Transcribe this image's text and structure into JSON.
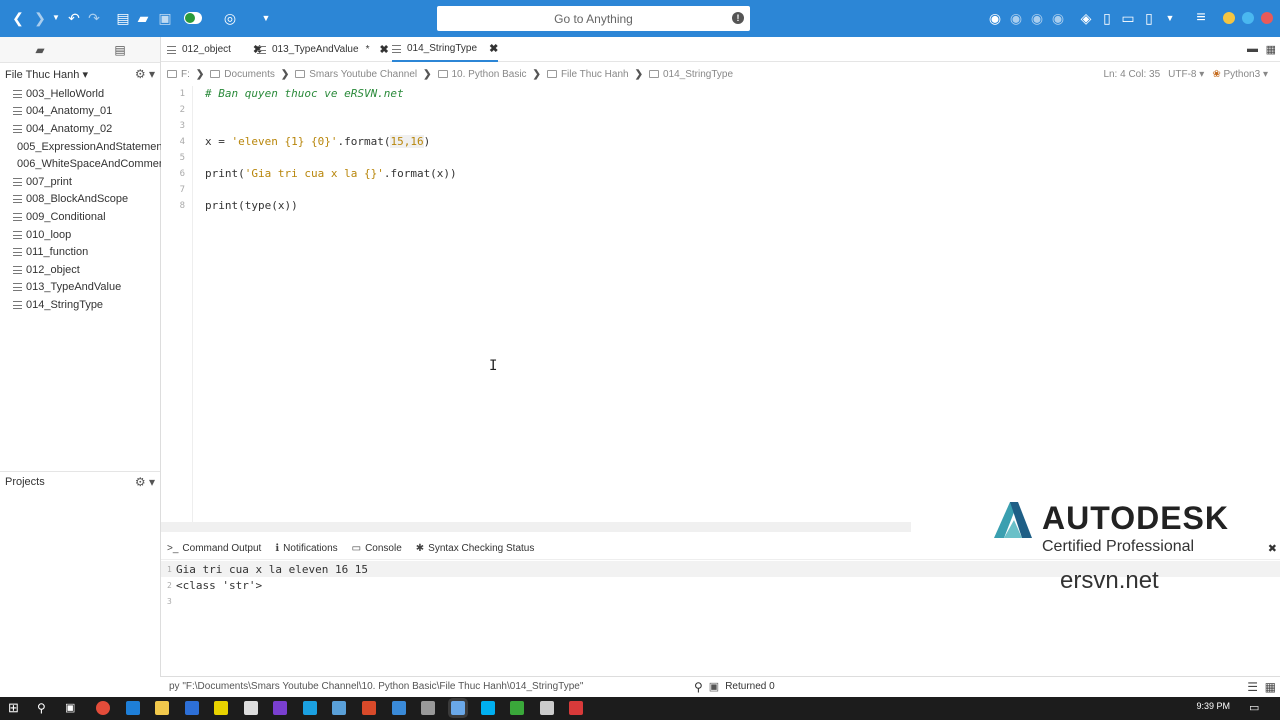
{
  "toolbar": {
    "goto_placeholder": "Go to Anything"
  },
  "sidebar": {
    "folder_name": "File Thuc Hanh",
    "items": [
      "003_HelloWorld",
      "004_Anatomy_01",
      "004_Anatomy_02",
      "005_ExpressionAndStatement",
      "006_WhiteSpaceAndComment",
      "007_print",
      "008_BlockAndScope",
      "009_Conditional",
      "010_loop",
      "011_function",
      "012_object",
      "013_TypeAndValue",
      "014_StringType"
    ],
    "projects_label": "Projects"
  },
  "tabs": [
    {
      "label": "012_object",
      "close": "✖"
    },
    {
      "label": "013_TypeAndValue",
      "modified": "*",
      "close": "✖"
    },
    {
      "label": "014_StringType",
      "close": "✖"
    }
  ],
  "breadcrumb": [
    "F:",
    "Documents",
    "Smars Youtube Channel",
    "10. Python Basic",
    "File Thuc Hanh",
    "014_StringType"
  ],
  "status": {
    "position": "Ln: 4 Col: 35",
    "encoding": "UTF-8",
    "language": "Python3"
  },
  "editor": {
    "line_numbers": [
      "1",
      "2",
      "3",
      "4",
      "5",
      "6",
      "7",
      "8"
    ],
    "line1": "# Ban quyen thuoc ve eRSVN.net",
    "line4_a": "x = ",
    "line4_str": "'eleven {1} {0}'",
    "line4_b": ".format(",
    "line4_args": "15,16",
    "line4_c": ")",
    "line6_a": "print(",
    "line6_str": "'Gia tri cua x la {}'",
    "line6_b": ".format(x))",
    "line8": "print(type(x))"
  },
  "panel": {
    "tabs": [
      "Command Output",
      "Notifications",
      "Console",
      "Syntax Checking Status"
    ],
    "output_lines": [
      "Gia tri cua x la eleven 16 15",
      "<class 'str'>",
      ""
    ],
    "output_line_numbers": [
      "1",
      "2",
      "3"
    ],
    "command": "py \"F:\\Documents\\Smars Youtube Channel\\10. Python Basic\\File Thuc Hanh\\014_StringType\"",
    "returned": "Returned 0",
    "close": "✖"
  },
  "watermark": {
    "brand": "AUTODESK",
    "cert": "Certified Professional",
    "site": "ersvn.net"
  },
  "taskbar": {
    "time": "9:39 PM"
  },
  "colors": {
    "accent": "#2c86d6",
    "comment": "#2a8a3a",
    "string": "#b8860b"
  }
}
